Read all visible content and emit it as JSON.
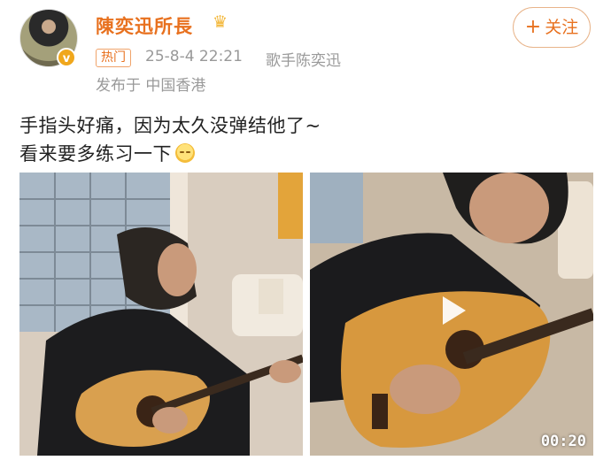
{
  "author": {
    "name": "陳奕迅所長",
    "crown_icon": "crown-icon",
    "verified_icon": "verified-badge-icon",
    "verified_color": "#f0a71c"
  },
  "meta": {
    "hot_tag": "热门",
    "time": "25-8-4 22:21",
    "source": "歌手陈奕迅",
    "location": "发布于 中国香港"
  },
  "follow": {
    "plus": "+",
    "label": "关注"
  },
  "post": {
    "line1": "手指头好痛，因为太久没弹结他了~",
    "line2": "看来要多练习一下",
    "emoji": "sleepy-face-emoji"
  },
  "media": {
    "photo_left": "photo",
    "video_right": "video",
    "play_icon": "play-icon",
    "duration": "00:20"
  },
  "colors": {
    "accent": "#e8711f",
    "meta": "#999999",
    "text": "#222222"
  }
}
